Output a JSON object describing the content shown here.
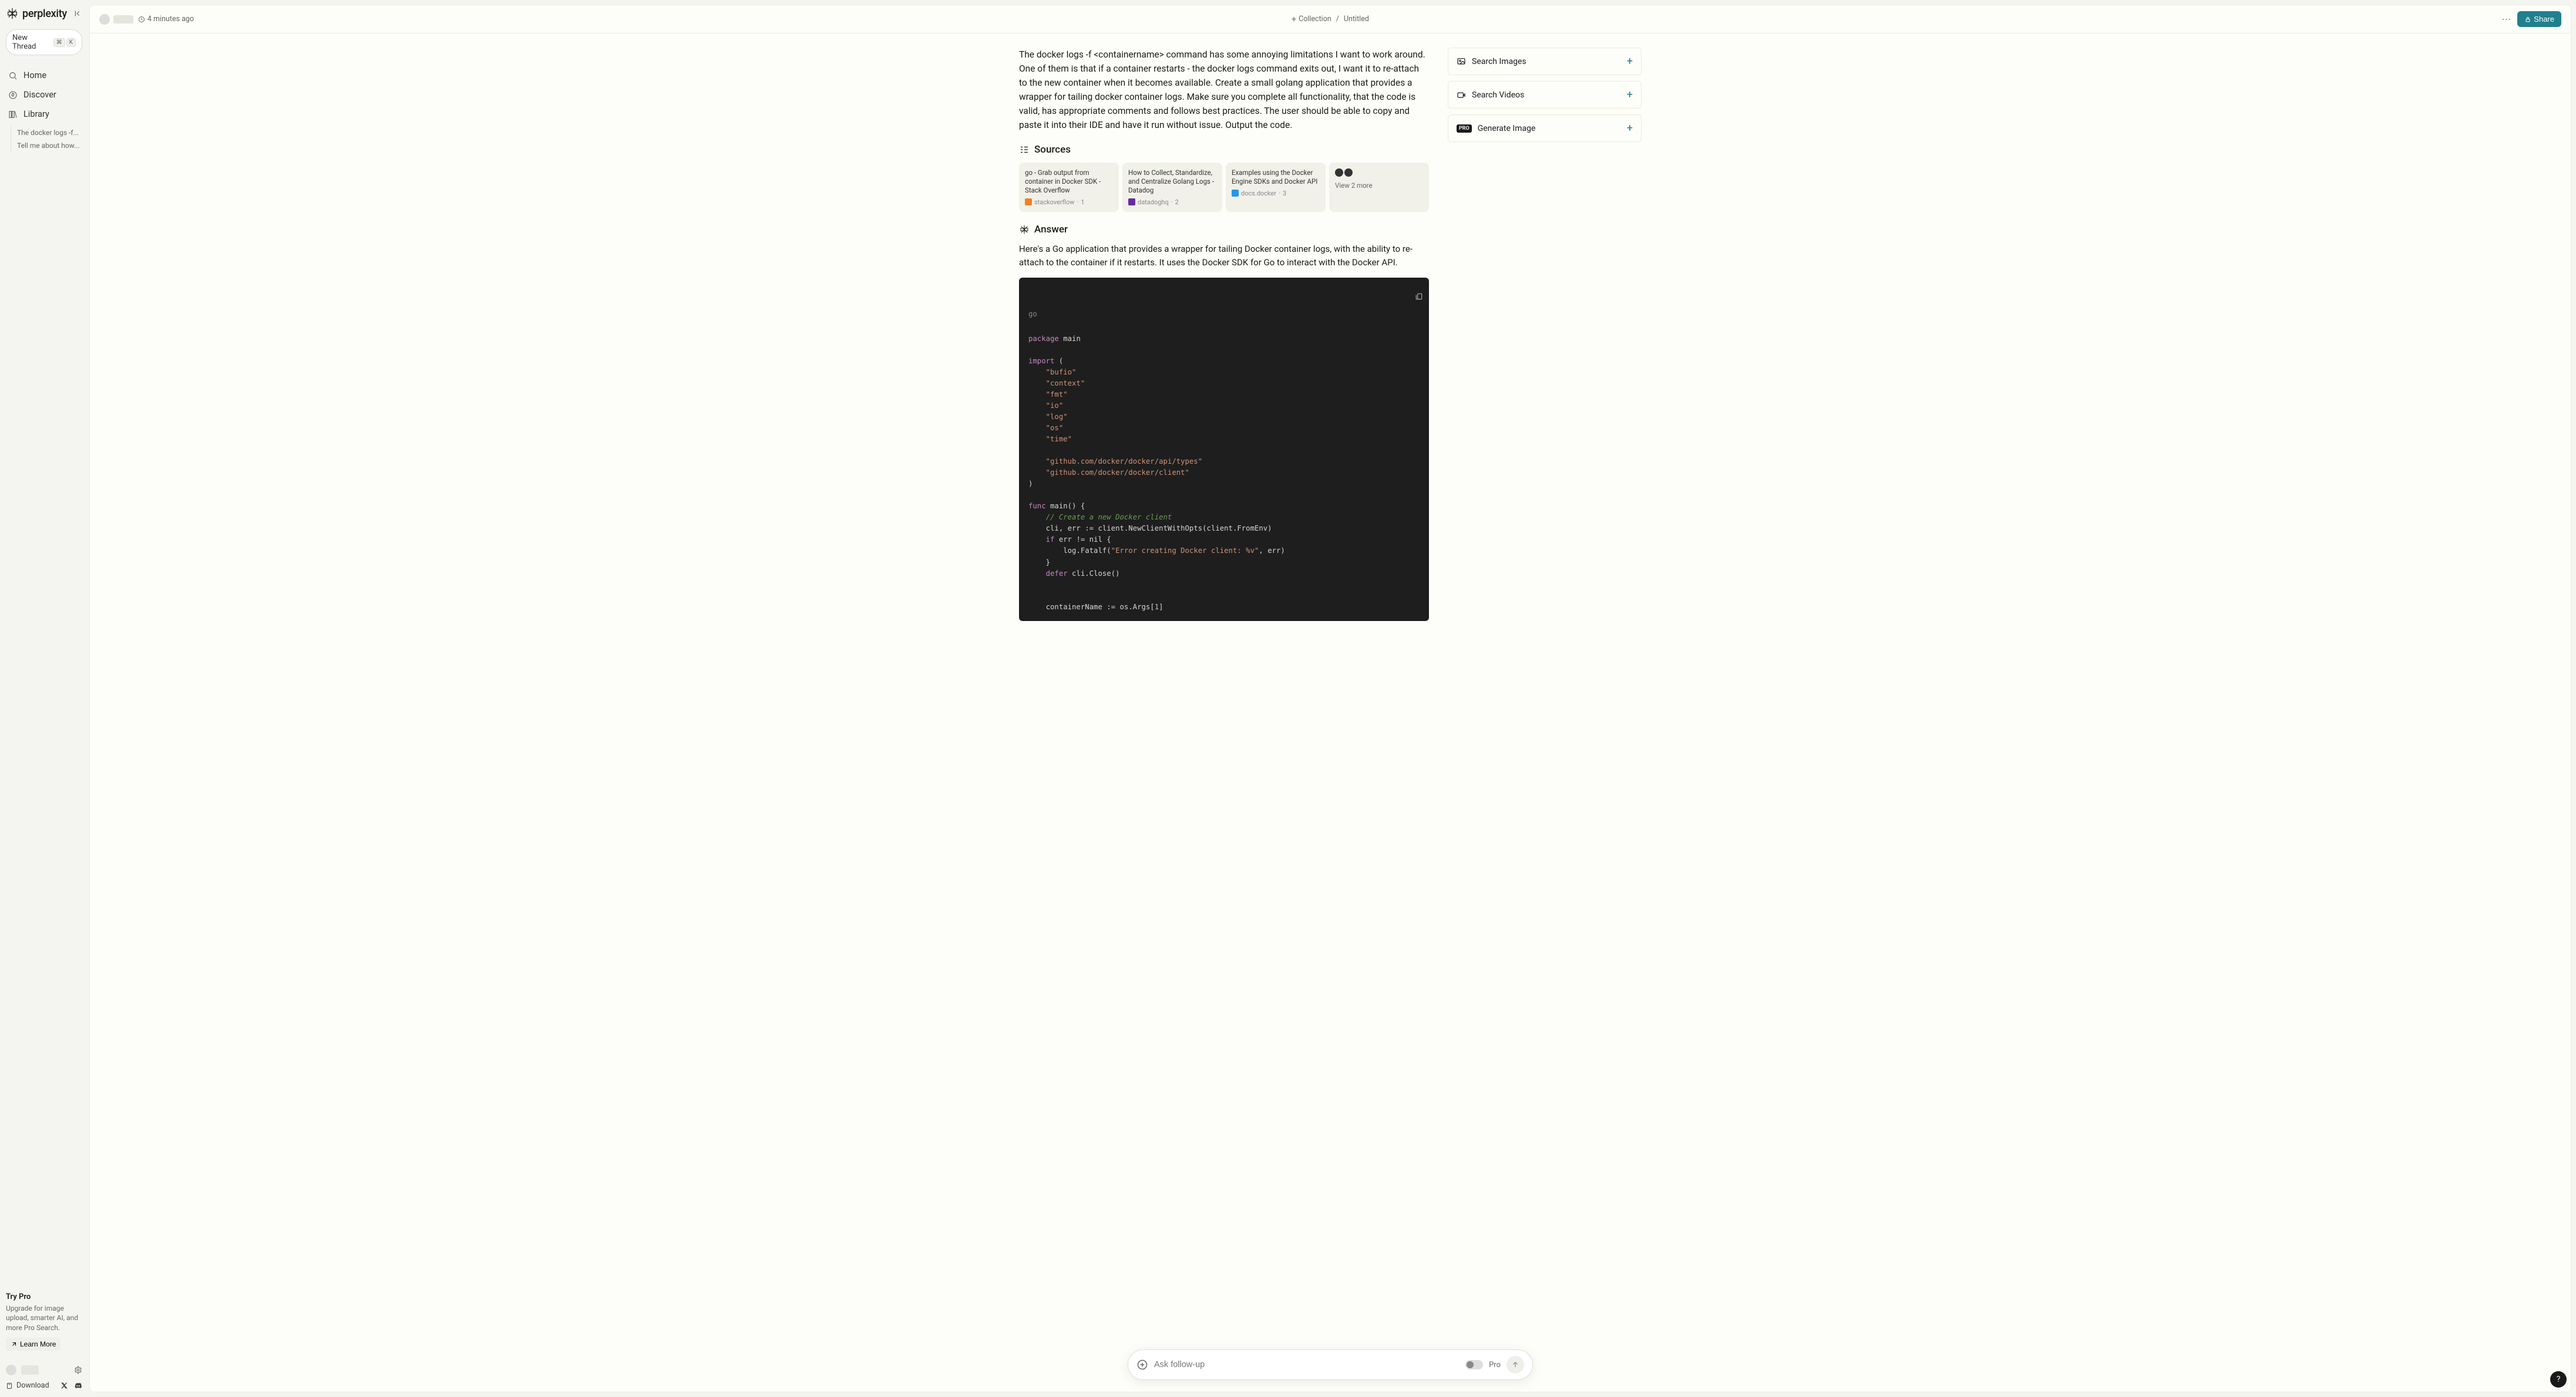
{
  "brand": "perplexity",
  "sidebar": {
    "new_thread": "New Thread",
    "kbd1": "⌘",
    "kbd2": "K",
    "home": "Home",
    "discover": "Discover",
    "library": "Library",
    "subitems": [
      "The docker logs -f...",
      "Tell me about how..."
    ],
    "try_pro_title": "Try Pro",
    "try_pro_desc": "Upgrade for image upload, smarter AI, and more Pro Search.",
    "learn_more": "Learn More",
    "download": "Download"
  },
  "topbar": {
    "time": "4 minutes ago",
    "collection": "Collection",
    "untitled": "Untitled",
    "share": "Share"
  },
  "thread": {
    "prompt": "The docker logs -f <containername> command has some annoying limitations I want to work around. One of them is that if a container restarts - the docker logs command exits out, I want it to re-attach to the new container when it becomes available. Create a small golang application that provides a wrapper for tailing docker container logs. Make sure you complete all functionality, that the code is valid, has appropriate comments and follows best practices. The user should be able to copy and paste it into their IDE and have it run without issue. Output the code.",
    "sources_title": "Sources",
    "sources": [
      {
        "title": "go - Grab output from container in Docker SDK - Stack Overflow",
        "site": "stackoverflow",
        "idx": "1"
      },
      {
        "title": "How to Collect, Standardize, and Centralize Golang Logs - Datadog",
        "site": "datadoghq",
        "idx": "2"
      },
      {
        "title": "Examples using the Docker Engine SDKs and Docker API",
        "site": "docs.docker",
        "idx": "3"
      }
    ],
    "view_more": "View 2 more",
    "answer_title": "Answer",
    "answer_intro": "Here's a Go application that provides a wrapper for tailing Docker container logs, with the ability to re-attach to the container if it restarts. It uses the Docker SDK for Go to interact with the Docker API.",
    "code_lang": "go",
    "code": {
      "l1": "package",
      "l1b": " main",
      "l3": "import",
      "l3b": " (",
      "imp": [
        "\"bufio\"",
        "\"context\"",
        "\"fmt\"",
        "\"io\"",
        "\"log\"",
        "\"os\"",
        "\"time\""
      ],
      "imp2": [
        "\"github.com/docker/docker/api/types\"",
        "\"github.com/docker/docker/client\""
      ],
      "close_paren": ")",
      "func_kw": "func",
      "main_sig": " main() {",
      "cmt1": "// Create a new Docker client",
      "cli_line": "    cli, err := client.NewClientWithOpts(client.FromEnv)",
      "if_kw": "if",
      "if_cond": " err != nil {",
      "fatal_pre": "        log.Fatalf(",
      "fatal_str": "\"Error creating Docker client: %v\"",
      "fatal_suf": ", err)",
      "close_brace": "    }",
      "defer_kw": "defer",
      "defer_body": " cli.Close()",
      "container_line_pre": "    containerName := os.Args[",
      "container_idx": "1",
      "container_line_suf": "]"
    }
  },
  "right": {
    "search_images": "Search Images",
    "search_videos": "Search Videos",
    "generate_image": "Generate Image",
    "pro_badge": "PRO"
  },
  "followup": {
    "placeholder": "Ask follow-up",
    "pro": "Pro"
  },
  "help": "?"
}
